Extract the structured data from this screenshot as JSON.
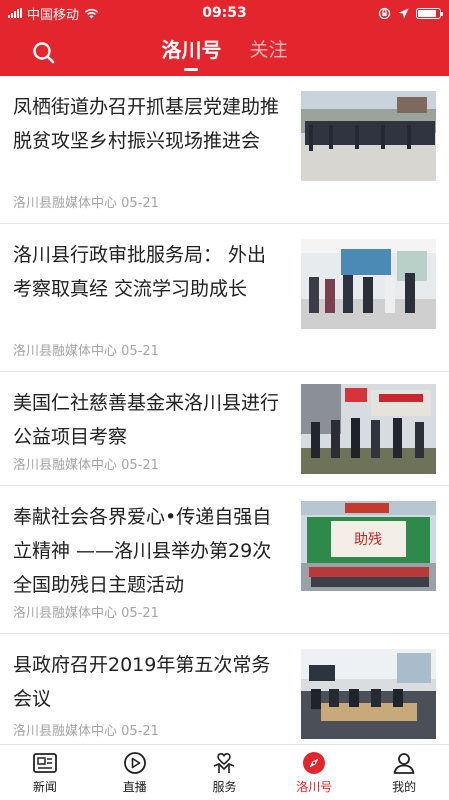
{
  "status_bar": {
    "carrier": "中国移动",
    "time": "09:53",
    "battery_level": 0.85
  },
  "header": {
    "tabs": [
      {
        "label": "洛川号",
        "active": true
      },
      {
        "label": "关注",
        "active": false
      }
    ]
  },
  "feed": [
    {
      "title": "凤栖街道办召开抓基层党建助推脱贫攻坚乡村振兴现场推进会",
      "source": "洛川县融媒体中心",
      "date": "05-21"
    },
    {
      "title": "洛川县行政审批服务局： 外出考察取真经 交流学习助成长",
      "source": "洛川县融媒体中心",
      "date": "05-21"
    },
    {
      "title": "美国仁社慈善基金来洛川县进行公益项目考察",
      "source": "洛川县融媒体中心",
      "date": "05-21"
    },
    {
      "title": "奉献社会各界爱心•传递自强自立精神 ——洛川县举办第29次全国助残日主题活动",
      "source": "洛川县融媒体中心",
      "date": "05-21"
    },
    {
      "title": "县政府召开2019年第五次常务会议",
      "source": "洛川县融媒体中心",
      "date": "05-21"
    }
  ],
  "tab_bar": [
    {
      "label": "新闻",
      "icon": "news-icon",
      "active": false
    },
    {
      "label": "直播",
      "icon": "live-play-icon",
      "active": false
    },
    {
      "label": "服务",
      "icon": "service-heart-icon",
      "active": false
    },
    {
      "label": "洛川号",
      "icon": "compass-icon",
      "active": true
    },
    {
      "label": "我的",
      "icon": "profile-icon",
      "active": false
    }
  ],
  "colors": {
    "brand_red": "#e3262e",
    "meta_gray": "#a6a6a6",
    "title_text": "#222222"
  }
}
